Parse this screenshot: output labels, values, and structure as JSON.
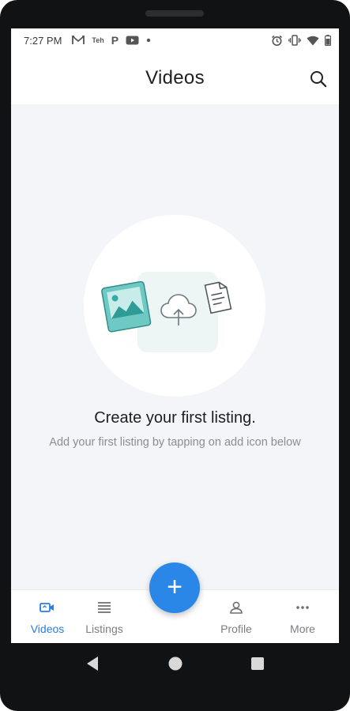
{
  "status_bar": {
    "time": "7:27 PM",
    "notification_icons": [
      "gmail-icon",
      "teh-icon",
      "p-icon",
      "youtube-icon",
      "dot-icon"
    ],
    "system_icons": [
      "alarm-icon",
      "vibrate-icon",
      "wifi-icon",
      "battery-icon"
    ],
    "teh_text": "Teh",
    "p_text": "P"
  },
  "header": {
    "title": "Videos",
    "search_icon": "search-icon"
  },
  "empty_state": {
    "title": "Create your first listing.",
    "subtitle": "Add your first listing by tapping on add icon below",
    "icons": [
      "image-icon",
      "cloud-upload-icon",
      "document-icon"
    ]
  },
  "bottom_nav": {
    "items": [
      {
        "label": "Videos",
        "icon": "video-camera-icon",
        "active": true
      },
      {
        "label": "Listings",
        "icon": "list-icon",
        "active": false
      },
      {
        "label": "Profile",
        "icon": "person-icon",
        "active": false
      },
      {
        "label": "More",
        "icon": "more-dots-icon",
        "active": false
      }
    ],
    "fab_label": "+"
  },
  "colors": {
    "accent": "#2a87e8",
    "active_nav": "#2a7de1",
    "background": "#f4f5f8",
    "illustration_teal": "#3bb3b0"
  }
}
